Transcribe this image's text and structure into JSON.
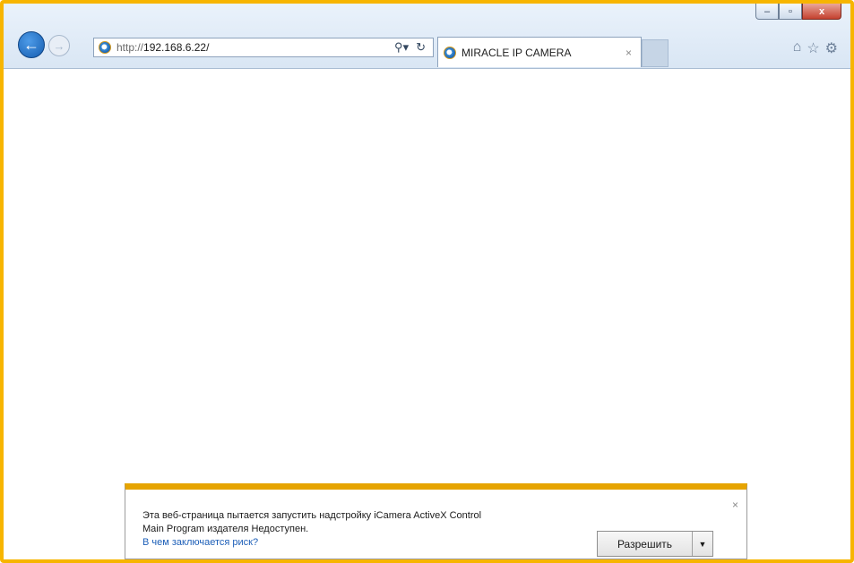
{
  "window": {
    "minimize": "–",
    "restore": "▫",
    "close": "x"
  },
  "nav": {
    "back_icon": "arrow-left-icon",
    "forward_icon": "arrow-right-icon"
  },
  "address_bar": {
    "protocol": "http://",
    "host": "192.168.6.22/",
    "search_icon": "search-icon",
    "refresh_icon": "refresh-icon"
  },
  "tab": {
    "title": "MIRACLE IP CAMERA",
    "close": "×"
  },
  "toolbar_icons": [
    "home-icon",
    "star-icon",
    "gear-icon"
  ],
  "notification": {
    "line1": "Эта веб-страница пытается запустить надстройку iCamera ActiveX Control",
    "line2": "Main Program издателя Недоступен.",
    "link": "В чем заключается риск?",
    "allow_label": "Разрешить",
    "close": "×"
  },
  "colors": {
    "frame_accent": "#f7b500",
    "notify_bar": "#e6a400",
    "link": "#1d5fb8"
  }
}
